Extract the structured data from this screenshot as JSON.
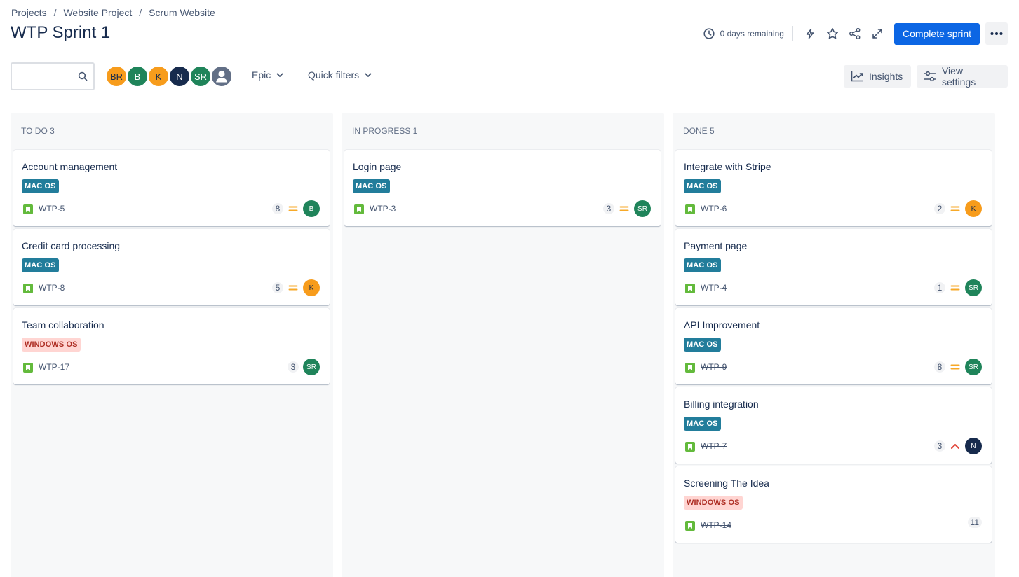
{
  "breadcrumb": [
    "Projects",
    "Website Project",
    "Scrum Website"
  ],
  "title": "WTP Sprint 1",
  "header": {
    "days_remaining": "0 days remaining",
    "complete_sprint": "Complete sprint"
  },
  "toolbar": {
    "search_value": "",
    "avatars": [
      {
        "initials": "BR",
        "color": "#f79c1c"
      },
      {
        "initials": "B",
        "color": "#1f845a"
      },
      {
        "initials": "K",
        "color": "#f79c1c"
      },
      {
        "initials": "N",
        "color": "#172b4d"
      },
      {
        "initials": "SR",
        "color": "#1f845a"
      },
      {
        "initials": "",
        "color": "#626f86"
      }
    ],
    "epic": "Epic",
    "quick_filters": "Quick filters",
    "insights": "Insights",
    "view_settings": "View settings"
  },
  "colors": {
    "primary": "#0c66e4",
    "mac_os_lozenge": "#227d9b",
    "windows_os_lozenge": "#ffd5d2",
    "story": "#63ba3c",
    "priority_medium": "#f7a928",
    "priority_high": "#e2483d"
  },
  "columns": [
    {
      "title": "TO DO 3",
      "cards": [
        {
          "title": "Account management",
          "label": "MAC OS",
          "key": "WTP-5",
          "points": "8",
          "priority": "medium",
          "assignee": "B"
        },
        {
          "title": "Credit card processing",
          "label": "MAC OS",
          "key": "WTP-8",
          "points": "5",
          "priority": "medium",
          "assignee": "K"
        },
        {
          "title": "Team collaboration",
          "label": "WINDOWS OS",
          "key": "WTP-17",
          "points": "3",
          "priority": "",
          "assignee": "SR"
        }
      ]
    },
    {
      "title": "IN PROGRESS 1",
      "cards": [
        {
          "title": "Login page",
          "label": "MAC OS",
          "key": "WTP-3",
          "points": "3",
          "priority": "medium",
          "assignee": "SR"
        }
      ]
    },
    {
      "title": "DONE 5",
      "cards": [
        {
          "title": "Integrate with Stripe",
          "label": "MAC OS",
          "key": "WTP-6",
          "points": "2",
          "priority": "medium",
          "assignee": "K"
        },
        {
          "title": "Payment page",
          "label": "MAC OS",
          "key": "WTP-4",
          "points": "1",
          "priority": "medium",
          "assignee": "SR"
        },
        {
          "title": "API Improvement",
          "label": "MAC OS",
          "key": "WTP-9",
          "points": "8",
          "priority": "medium",
          "assignee": "SR"
        },
        {
          "title": "Billing integration",
          "label": "MAC OS",
          "key": "WTP-7",
          "points": "3",
          "priority": "high",
          "assignee": "N"
        },
        {
          "title": "Screening The Idea",
          "label": "WINDOWS OS",
          "key": "WTP-14",
          "points": "11",
          "priority": "",
          "assignee": ""
        }
      ]
    }
  ]
}
